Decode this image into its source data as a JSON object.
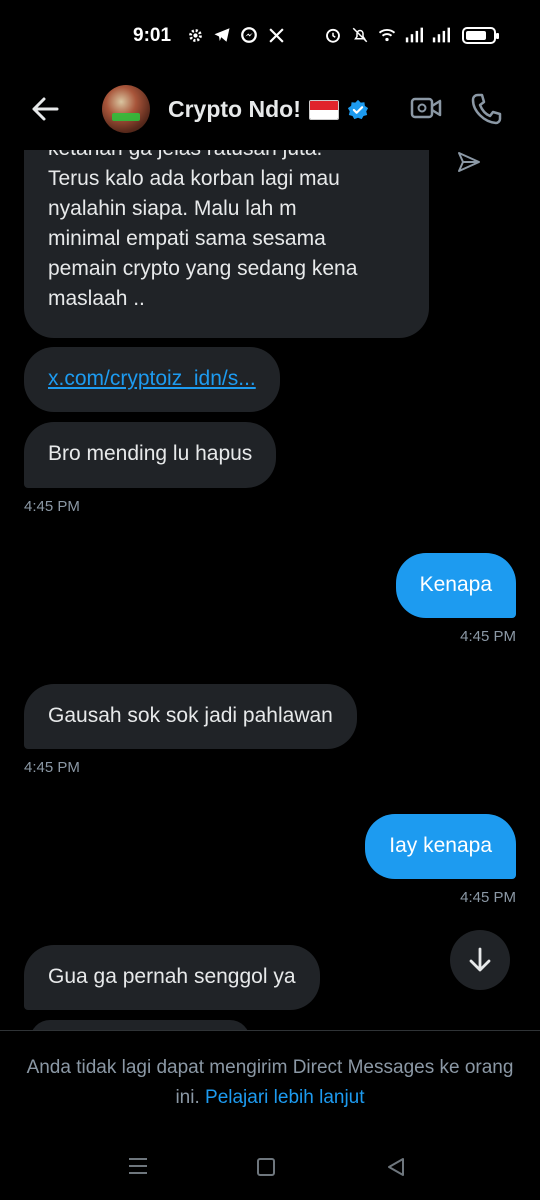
{
  "status_bar": {
    "time": "9:01",
    "left_icons": [
      "gear-icon",
      "telegram-icon",
      "messenger-icon",
      "x-icon"
    ],
    "right_icons": [
      "alarm-icon",
      "mute-icon",
      "wifi-icon",
      "signal-icon",
      "signal-icon"
    ],
    "battery_level": 0.75
  },
  "header": {
    "name": "Crypto Ndo!",
    "flag": "indonesia-flag",
    "verified": true,
    "back_icon": "arrow-left-icon",
    "video_icon": "video-call-icon",
    "phone_icon": "phone-icon"
  },
  "messages": [
    {
      "direction": "in",
      "text": "ketahan ga jelas ratusan juta.\nTerus kalo ada korban lagi mau\nnyalahin siapa. Malu lah m\nminimal empati sama sesama\npemain crypto yang sedang kena\nmaslaah .."
    },
    {
      "direction": "in",
      "text": "x.com/cryptoiz_idn/s...",
      "is_link": true
    },
    {
      "direction": "in",
      "text": "Bro mending lu hapus",
      "time": "4:45 PM"
    },
    {
      "direction": "out",
      "text": "Kenapa",
      "time": "4:45 PM"
    },
    {
      "direction": "in",
      "text": "Gausah sok sok jadi pahlawan",
      "time": "4:45 PM"
    },
    {
      "direction": "out",
      "text": "Iay kenapa",
      "time": "4:45 PM"
    },
    {
      "direction": "in",
      "text": "Gua ga pernah senggol ya"
    }
  ],
  "footer": {
    "notice": "Anda tidak lagi dapat mengirim Direct Messages ke orang ini.",
    "learn_more": "Pelajari lebih lanjut"
  },
  "colors": {
    "background": "#000000",
    "incoming_bubble": "#202327",
    "outgoing_bubble": "#1d9bf0",
    "link": "#1d9bf0",
    "muted_text": "#8b98a5"
  }
}
